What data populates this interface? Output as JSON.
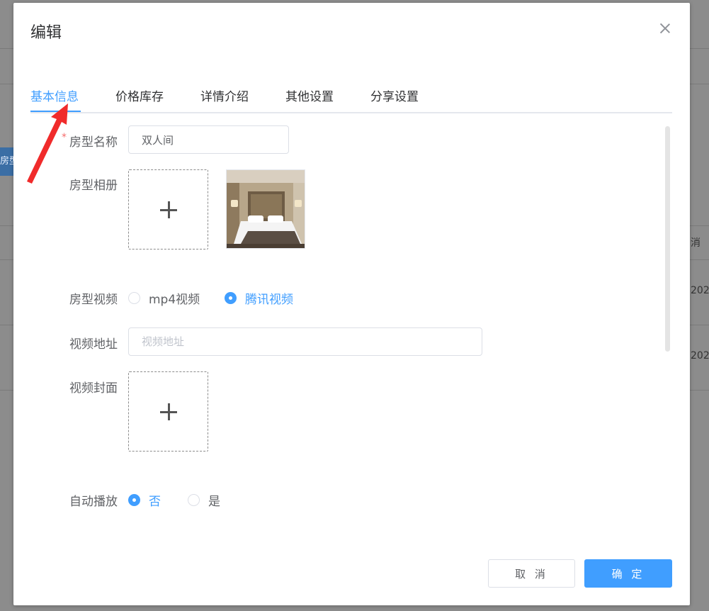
{
  "background": {
    "side_button_text": "房型",
    "right_col_texts": [
      "消",
      "202",
      "202"
    ]
  },
  "dialog": {
    "title": "编辑",
    "tabs": [
      {
        "label": "基本信息",
        "active": true
      },
      {
        "label": "价格库存",
        "active": false
      },
      {
        "label": "详情介绍",
        "active": false
      },
      {
        "label": "其他设置",
        "active": false
      },
      {
        "label": "分享设置",
        "active": false
      }
    ],
    "form": {
      "room_name": {
        "required_mark": "*",
        "label": "房型名称",
        "value": "双人间"
      },
      "album": {
        "label": "房型相册"
      },
      "video_type": {
        "label": "房型视频",
        "options": [
          "mp4视频",
          "腾讯视频"
        ],
        "selected": "腾讯视频"
      },
      "video_url": {
        "label": "视频地址",
        "placeholder": "视频地址",
        "value": ""
      },
      "video_cover": {
        "label": "视频封面"
      },
      "autoplay": {
        "label": "自动播放",
        "options": [
          "否",
          "是"
        ],
        "selected": "否"
      }
    },
    "footer": {
      "cancel_label": "取 消",
      "ok_label": "确 定"
    }
  },
  "colors": {
    "accent": "#409eff",
    "required": "#f56c6c",
    "annotation_arrow": "#f02b2b"
  },
  "icons": {
    "close": "close-icon",
    "upload": "plus-icon"
  }
}
